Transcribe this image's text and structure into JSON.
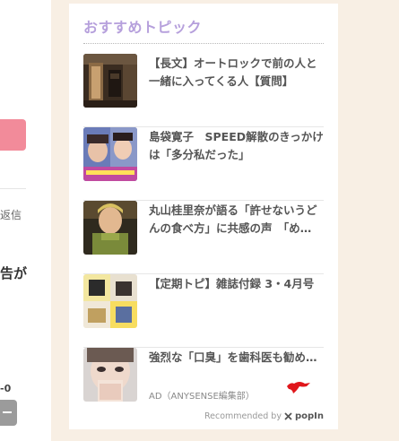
{
  "left": {
    "reply_text": "返信",
    "bold_text": "告が",
    "number_text": "-0"
  },
  "widget": {
    "title": "おすすめトピック",
    "items": [
      {
        "text": "【長文】オートロックで前の人と一緒に入ってくる人【質問】"
      },
      {
        "text": "島袋寛子　SPEED解散のきっかけは「多分私だった」"
      },
      {
        "text": "丸山桂里奈が語る「許せないうどんの食べ方」に共感の声　「め…"
      },
      {
        "text": "【定期トピ】雑誌付録 3・4月号"
      },
      {
        "text": "強烈な「口臭」を歯科医も勧め…",
        "ad_label": "AD（ANYSENSE編集部）"
      }
    ],
    "recommended_by": "Recommended by",
    "brand": "popIn"
  },
  "colors": {
    "page_bg": "#f8efe4",
    "title": "#b6a0dc",
    "pink_button": "#f28b9a",
    "red_mark": "#e0161b"
  }
}
